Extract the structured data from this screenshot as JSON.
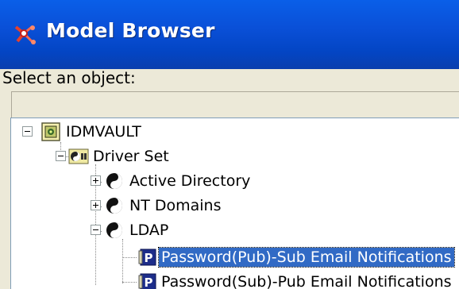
{
  "window": {
    "title": "Model Browser"
  },
  "prompt": {
    "select_label": "Select an object:"
  },
  "search": {
    "value": ""
  },
  "tree": {
    "nodes": [
      {
        "label": "IDMVAULT",
        "icon": "vault-icon",
        "expander": "collapse"
      },
      {
        "label": "Driver Set",
        "icon": "driver-set-icon",
        "expander": "collapse"
      },
      {
        "label": "Active Directory",
        "icon": "driver-yinyang-icon",
        "expander": "expand"
      },
      {
        "label": "NT Domains",
        "icon": "driver-yinyang-icon",
        "expander": "expand"
      },
      {
        "label": "LDAP",
        "icon": "driver-yinyang-icon",
        "expander": "collapse"
      },
      {
        "label": "Password(Pub)-Sub Email Notifications",
        "icon": "policy-p-icon",
        "selected": true
      },
      {
        "label": "Password(Sub)-Pub Email Notifications",
        "icon": "policy-p-icon"
      }
    ]
  }
}
